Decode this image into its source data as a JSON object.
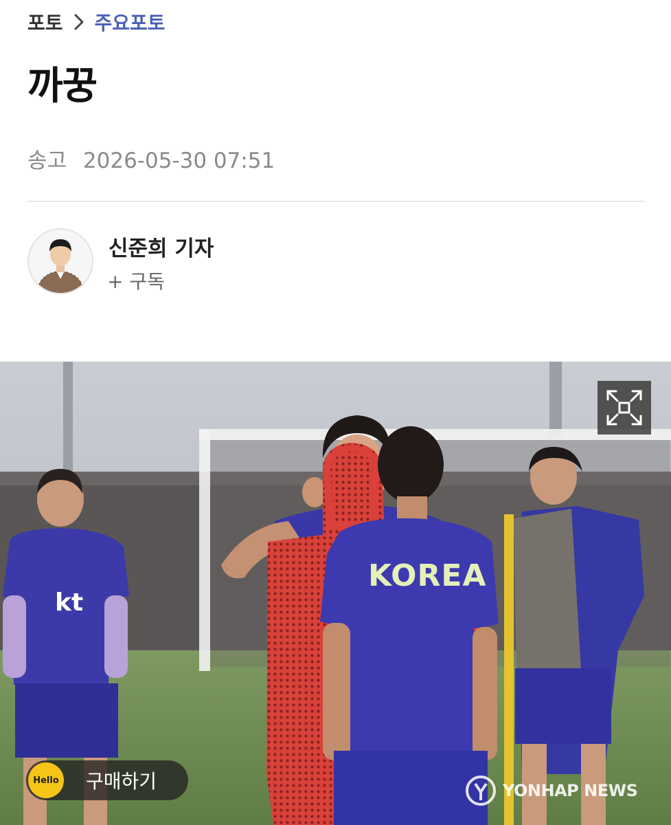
{
  "breadcrumb": {
    "root": "포토",
    "current": "주요포토"
  },
  "article": {
    "title": "까꿍",
    "date_label": "송고",
    "date": "2026-05-30 07:51"
  },
  "reporter": {
    "name": "신준희 기자",
    "subscribe_label": "+ 구독"
  },
  "photo": {
    "jersey_text": "KOREA",
    "sponsor_text": "kt",
    "buy_label": "구매하기",
    "buy_icon_text": "Hello",
    "watermark": "YONHAP NEWS"
  }
}
